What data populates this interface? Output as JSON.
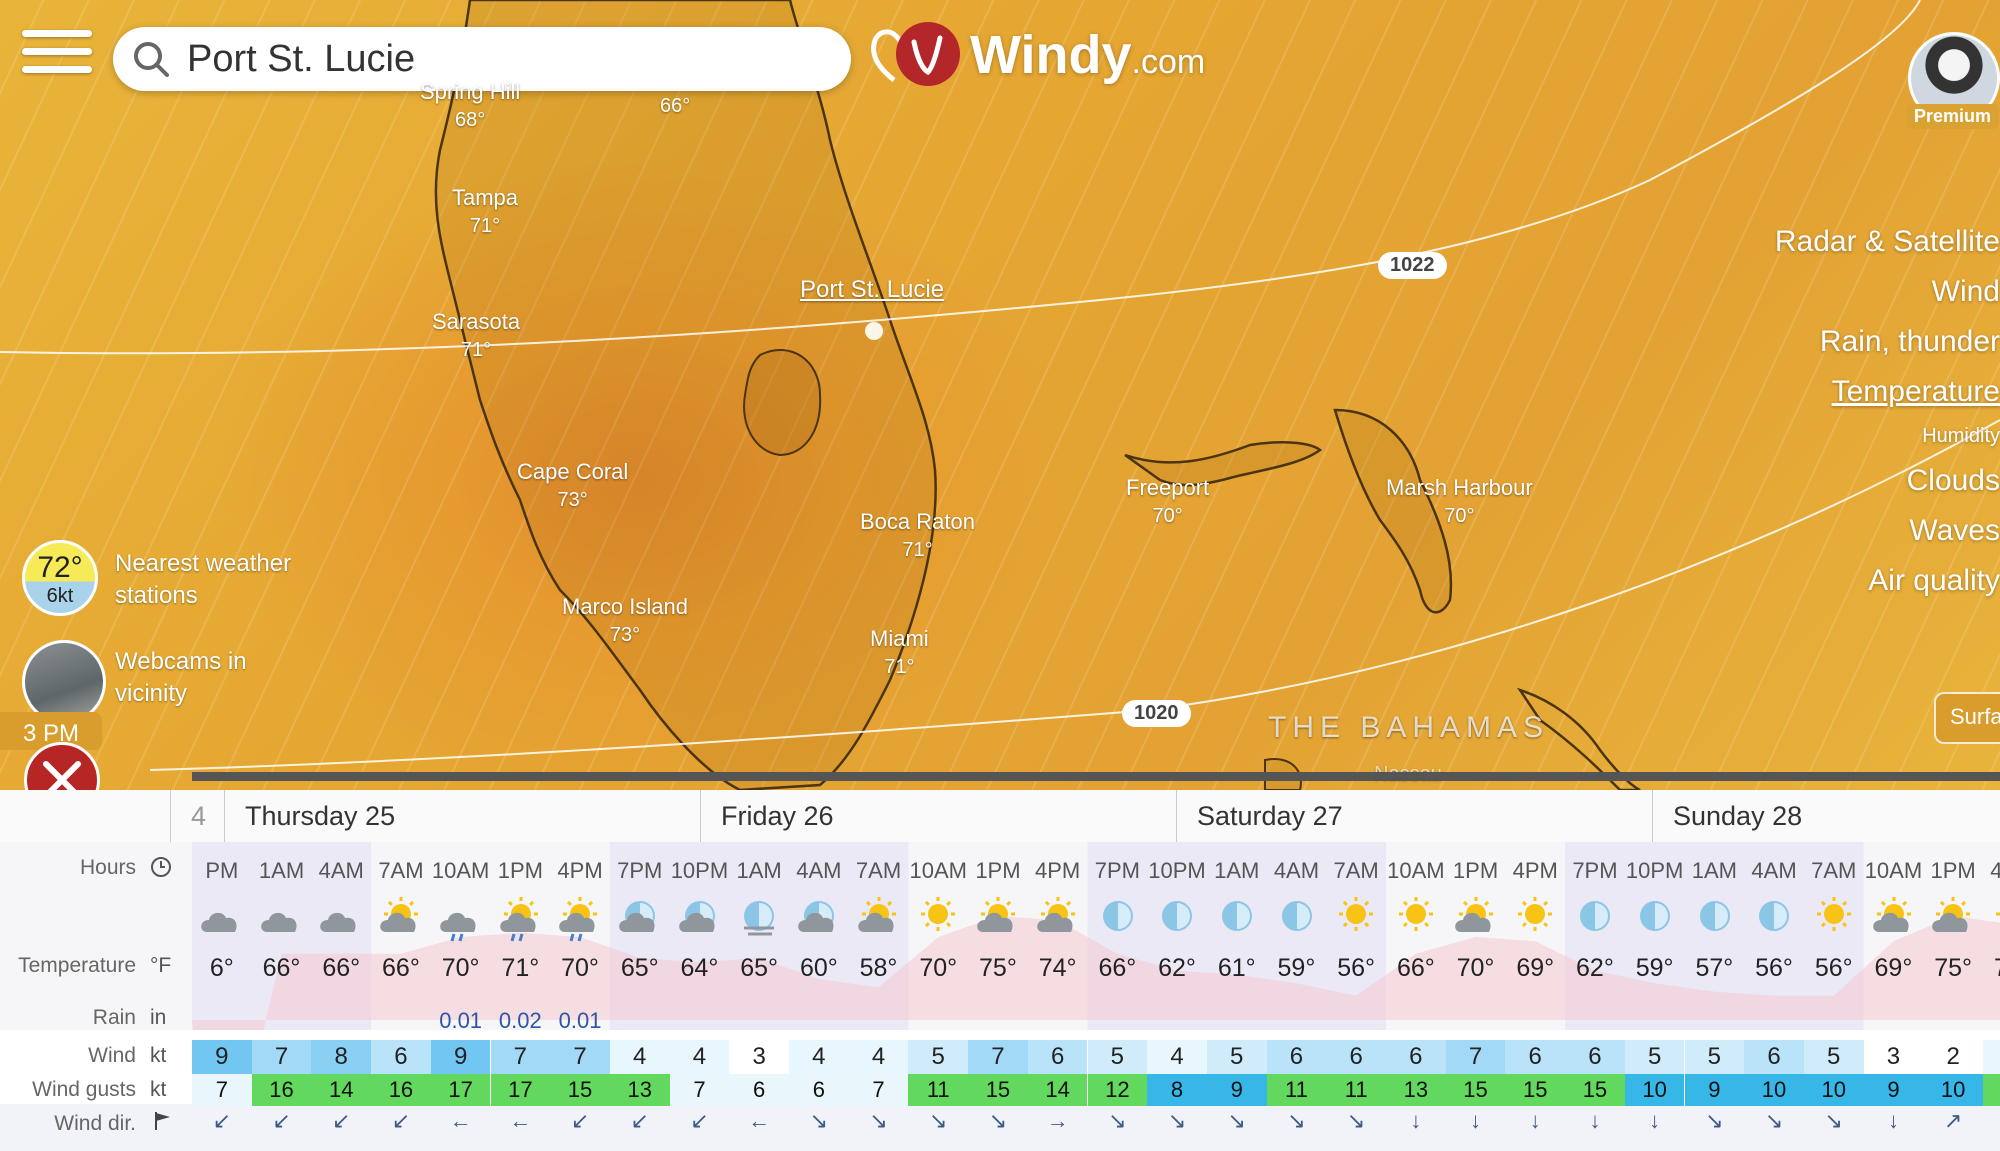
{
  "search": {
    "value": "Port St. Lucie",
    "placeholder": "Search location"
  },
  "brand": {
    "name": "Windy",
    "suffix": ".com"
  },
  "account": {
    "badge": "Premium"
  },
  "layers": [
    {
      "label": "Radar & Satellite",
      "size": "normal",
      "active": false
    },
    {
      "label": "Wind",
      "size": "normal",
      "active": false
    },
    {
      "label": "Rain, thunder",
      "size": "normal",
      "active": false
    },
    {
      "label": "Temperature",
      "size": "normal",
      "active": true
    },
    {
      "label": "Humidity",
      "size": "small",
      "active": false
    },
    {
      "label": "Clouds",
      "size": "normal",
      "active": false
    },
    {
      "label": "Waves",
      "size": "normal",
      "active": false
    },
    {
      "label": "Air quality",
      "size": "normal",
      "active": false
    }
  ],
  "surface_button": "Surface",
  "map": {
    "cities": [
      {
        "name": "Spring Hill",
        "temp": "68°"
      },
      {
        "name": "",
        "temp": "66°"
      },
      {
        "name": "Tampa",
        "temp": "71°"
      },
      {
        "name": "Sarasota",
        "temp": "71°"
      },
      {
        "name": "Cape Coral",
        "temp": "73°"
      },
      {
        "name": "Marco Island",
        "temp": "73°"
      },
      {
        "name": "Boca Raton",
        "temp": "71°"
      },
      {
        "name": "Miami",
        "temp": "71°"
      },
      {
        "name": "Freeport",
        "temp": "70°"
      },
      {
        "name": "Marsh Harbour",
        "temp": "70°"
      }
    ],
    "selected_location": "Port St. Lucie",
    "isobars": [
      "1022",
      "1020"
    ],
    "region_label": "THE BAHAMAS",
    "small_label": "Nassau"
  },
  "nearest_station": {
    "temp": "72°",
    "wind": "6kt",
    "label": "Nearest weather stations"
  },
  "webcams": {
    "label": "Webcams in vicinity"
  },
  "time_chip": "3 PM",
  "timeline_position": 0.05,
  "forecast": {
    "days": [
      "Thursday 25",
      "Friday 26",
      "Saturday 27",
      "Sunday 28"
    ],
    "prev_day_fragment": "4",
    "labels": {
      "hours": "Hours",
      "temperature": "Temperature",
      "rain": "Rain",
      "wind": "Wind",
      "gusts": "Wind gusts",
      "dir": "Wind dir."
    },
    "units": {
      "temperature": "°F",
      "rain": "in",
      "wind": "kt",
      "gusts": "kt"
    },
    "hours": [
      "PM",
      "1AM",
      "4AM",
      "7AM",
      "10AM",
      "1PM",
      "4PM",
      "7PM",
      "10PM",
      "1AM",
      "4AM",
      "7AM",
      "10AM",
      "1PM",
      "4PM",
      "7PM",
      "10PM",
      "1AM",
      "4AM",
      "7AM",
      "10AM",
      "1PM",
      "4PM",
      "7PM",
      "10PM",
      "1AM",
      "4AM",
      "7AM",
      "10AM",
      "1PM",
      "4PM"
    ],
    "icons": [
      "cloud",
      "cloud",
      "cloud",
      "partly-cloudy",
      "rain",
      "rain-sun",
      "rain-sun",
      "partly-cloudy-night",
      "partly-cloudy-night",
      "fog-night",
      "partly-cloudy-night",
      "partly-cloudy",
      "sun",
      "partly-cloudy",
      "partly-cloudy",
      "moon",
      "moon",
      "moon",
      "moon",
      "sun",
      "sun",
      "partly-cloudy",
      "sun",
      "moon",
      "moon",
      "moon",
      "moon",
      "sun",
      "partly-cloudy",
      "partly-cloudy",
      "sun"
    ],
    "temps": [
      "6°",
      "66°",
      "66°",
      "66°",
      "70°",
      "71°",
      "70°",
      "65°",
      "64°",
      "65°",
      "60°",
      "58°",
      "70°",
      "75°",
      "74°",
      "66°",
      "62°",
      "61°",
      "59°",
      "56°",
      "66°",
      "70°",
      "69°",
      "62°",
      "59°",
      "57°",
      "56°",
      "56°",
      "69°",
      "75°",
      "73°"
    ],
    "rain": [
      "",
      "",
      "",
      "",
      "0.01",
      "0.02",
      "0.01",
      "",
      "",
      "",
      "",
      "",
      "",
      "",
      "",
      "",
      "",
      "",
      "",
      "",
      "",
      "",
      "",
      "",
      "",
      "",
      "",
      "",
      "",
      "",
      ""
    ],
    "wind": [
      "9",
      "7",
      "8",
      "6",
      "9",
      "7",
      "7",
      "4",
      "4",
      "3",
      "4",
      "4",
      "5",
      "7",
      "6",
      "5",
      "4",
      "5",
      "6",
      "6",
      "6",
      "7",
      "6",
      "6",
      "5",
      "5",
      "6",
      "5",
      "3",
      "2",
      "4"
    ],
    "gusts": [
      "7",
      "16",
      "14",
      "16",
      "17",
      "17",
      "15",
      "13",
      "7",
      "6",
      "6",
      "7",
      "11",
      "15",
      "14",
      "12",
      "8",
      "9",
      "11",
      "11",
      "13",
      "15",
      "15",
      "15",
      "10",
      "9",
      "10",
      "10",
      "9",
      "10",
      "11"
    ],
    "wind_dir": [
      "↙",
      "↙",
      "↙",
      "↙",
      "←",
      "←",
      "↙",
      "↙",
      "↙",
      "←",
      "↘",
      "↘",
      "↘",
      "↘",
      "→",
      "↘",
      "↘",
      "↘",
      "↘",
      "↘",
      "↓",
      "↓",
      "↓",
      "↓",
      "↓",
      "↘",
      "↘",
      "↘",
      "↓",
      "↗",
      "→"
    ],
    "colors": {
      "night_band": "#ece9f7",
      "temp_band": "#f4c9cf",
      "wind_low": "#ffffff",
      "wind_high": "#5bbdf0",
      "gust_green": "#62d85e",
      "gust_blue": "#37b6e8"
    }
  }
}
